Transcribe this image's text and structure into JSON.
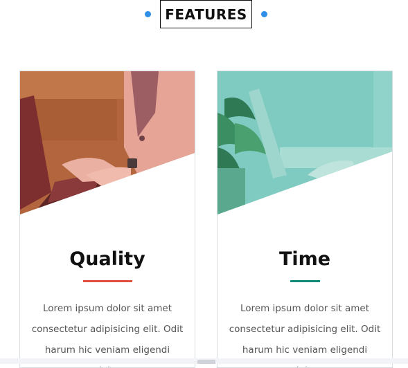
{
  "header": {
    "title": "FEATURES",
    "dot_color": "#2f8fe8"
  },
  "cards": [
    {
      "title": "Quality",
      "accent": "#e04e3d",
      "image_icon": "woman-with-laptop-photo",
      "text": "Lorem ipsum dolor sit amet consectetur adipisicing elit. Odit harum hic veniam eligendi minima"
    },
    {
      "title": "Time",
      "accent": "#128a7a",
      "image_icon": "office-plant-photo",
      "text": "Lorem ipsum dolor sit amet consectetur adipisicing elit. Odit harum hic veniam eligendi minima"
    }
  ]
}
